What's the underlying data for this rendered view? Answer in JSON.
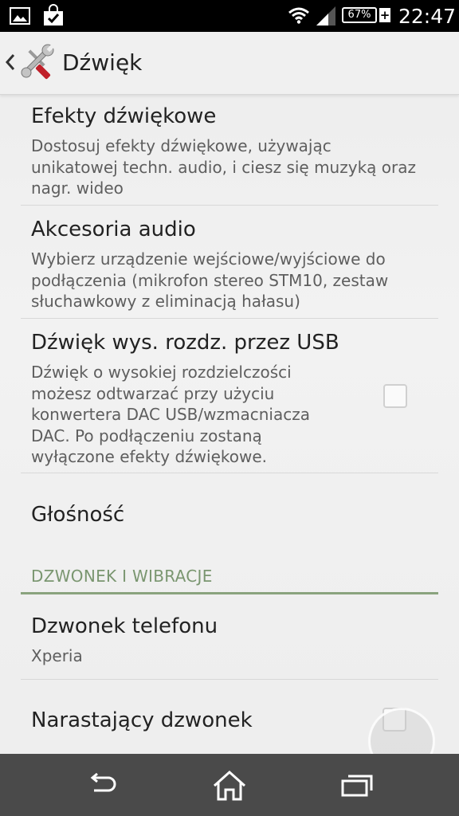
{
  "status_bar": {
    "left_icons": [
      "gallery-icon",
      "shopping-bag-check-icon"
    ],
    "right_icons": [
      "wifi-icon",
      "signal-icon"
    ],
    "battery_percent": "67%",
    "charging": "+",
    "time": "22:47"
  },
  "action_bar": {
    "title": "Dźwięk",
    "icon": "tools-icon"
  },
  "settings": {
    "sound_effects": {
      "title": "Efekty dźwiękowe",
      "summary_lines": [
        "Dostosuj efekty dźwiękowe, używając",
        "unikatowej techn. audio, i ciesz się muzyką oraz",
        "nagr. wideo"
      ]
    },
    "audio_accessories": {
      "title": "Akcesoria audio",
      "summary_lines": [
        "Wybierz urządzenie wejściowe/wyjściowe do",
        "podłączenia (mikrofon stereo STM10, zestaw",
        "słuchawkowy z eliminacją hałasu)"
      ]
    },
    "hires_usb": {
      "title": "Dźwięk wys. rozdz. przez USB",
      "summary_lines": [
        "Dźwięk o wysokiej rozdzielczości",
        "możesz odtwarzać przy użyciu",
        "konwertera DAC USB/wzmacniacza",
        "DAC. Po podłączeniu zostaną",
        "wyłączone efekty dźwiękowe."
      ],
      "checked": false
    },
    "volume": {
      "title": "Głośność"
    },
    "category_ringtone": {
      "title": "DZWONEK I WIBRACJE"
    },
    "phone_ringtone": {
      "title": "Dzwonek telefonu",
      "summary": "Xperia"
    },
    "ascending_ringtone": {
      "title": "Narastający dzwonek",
      "checked": false
    }
  },
  "nav_bar": {
    "buttons": [
      "back-icon",
      "home-icon",
      "recent-apps-icon"
    ]
  },
  "colors": {
    "category_accent": "#7a9670",
    "status_bar": "#000000",
    "nav_bar": "#4a4a4a"
  }
}
